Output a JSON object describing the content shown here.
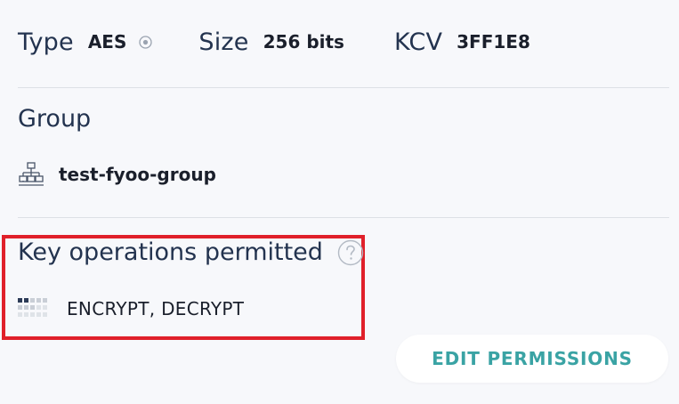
{
  "key_details": {
    "type_label": "Type",
    "type_value": "AES",
    "type_info_icon": "info-dot-icon",
    "size_label": "Size",
    "size_value": "256 bits",
    "kcv_label": "KCV",
    "kcv_value": "3FF1E8"
  },
  "group": {
    "title": "Group",
    "icon": "hierarchy-icon",
    "name": "test-fyoo-group"
  },
  "key_operations": {
    "title": "Key operations permitted",
    "help_icon": "help-icon",
    "ops_icon": "grid-icon",
    "value": "ENCRYPT, DECRYPT"
  },
  "actions": {
    "edit_permissions_label": "EDIT PERMISSIONS"
  },
  "colors": {
    "background": "#f7f8fb",
    "heading": "#23334f",
    "value_text": "#1a1f2b",
    "divider": "#dde0e6",
    "highlight_border": "#e0202a",
    "button_text": "#3aa3a4",
    "button_bg": "#ffffff",
    "icon_gray": "#9aa3b0"
  }
}
